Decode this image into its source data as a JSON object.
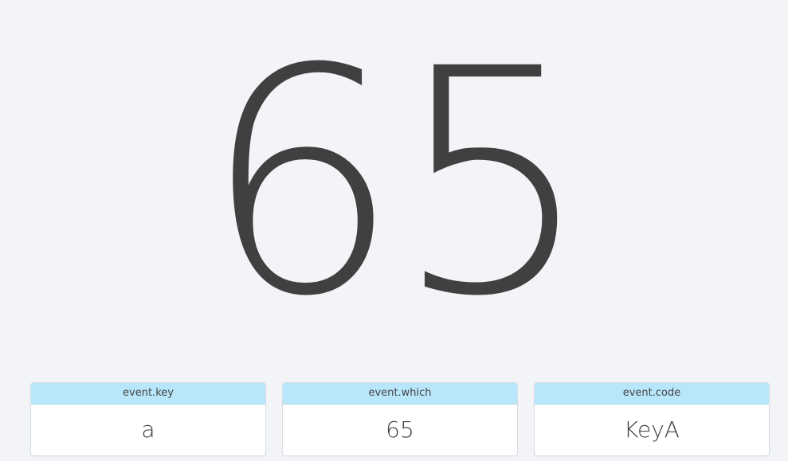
{
  "display": {
    "main_value": "65"
  },
  "cards": [
    {
      "title": "event.key",
      "value": "a"
    },
    {
      "title": "event.which",
      "value": "65"
    },
    {
      "title": "event.code",
      "value": "KeyA"
    }
  ],
  "colors": {
    "background": "#f2f4f8",
    "text": "#404040",
    "card_header": "#b8e6fb",
    "card_body": "#ffffff"
  }
}
